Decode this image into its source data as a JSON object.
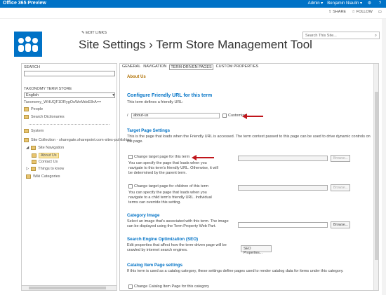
{
  "topbar": {
    "brand": "Office 365 Preview",
    "admin": "Admin ▾",
    "user": "Benjamin Niaulin ▾"
  },
  "actions": {
    "share": "SHARE",
    "follow": "FOLLOW"
  },
  "header": {
    "edit_links": "EDIT LINKS",
    "title": "Site Settings › Term Store Management Tool",
    "search_placeholder": "Search This Site..."
  },
  "left": {
    "search_label": "SEARCH",
    "store_label": "TAXONOMY TERM STORE",
    "language": "English",
    "store_name": "Taxonomy_WHUQF1DRygOuWeMdxE8rA==",
    "items": {
      "people": "People",
      "search_dict": "Search Dictionaries",
      "system": "System",
      "site_collection": "Site Collection - sharegate.sharepoint.com-sites-publishing",
      "site_nav": "Site Navigation",
      "about_us": "About Us",
      "contact_us": "Contact Us",
      "things": "Things to know",
      "wiki": "Wiki Categories"
    }
  },
  "tabs": {
    "general": "GENERAL",
    "navigation": "NAVIGATION",
    "term_driven": "TERM-DRIVEN PAGES",
    "custom": "CUSTOM PROPERTIES"
  },
  "main": {
    "term_name": "About Us",
    "friendly_heading": "Configure Friendly URL for this term",
    "friendly_desc": "This term defines a friendly URL:",
    "url_prefix": "/",
    "url_value": "about-us",
    "customize": "Customize",
    "target_heading": "Target Page Settings",
    "target_desc": "This is the page that loads when the Friendly URL is accessed. The term context passed to this page can be used to drive dynamic controls on the page.",
    "change_target": "Change target page for this term",
    "change_target_desc": "You can specify the page that loads when you navigate to this term's friendly URL. Otherwise, it will be determined by the parent term.",
    "change_children": "Change target page for children of this term",
    "change_children_desc": "You can specify the page that loads when you navigate to a child term's friendly URL. Individual terms can override this setting.",
    "browse": "Browse...",
    "category_heading": "Category Image",
    "category_desc": "Select an image that's associated with this term. The image can be displayed using the Term Property Web Part.",
    "seo_heading": "Search Engine Optimization (SEO)",
    "seo_desc": "Edit properties that affect how the term-driven page will be crawled by internet search engines.",
    "seo_button": "SEO Properties...",
    "catalog_heading": "Catalog Item Page settings",
    "catalog_desc": "If this term is used as a catalog category, these settings define pages used to render catalog data for items under this category.",
    "catalog_change": "Change Catalog Item Page for this category"
  }
}
